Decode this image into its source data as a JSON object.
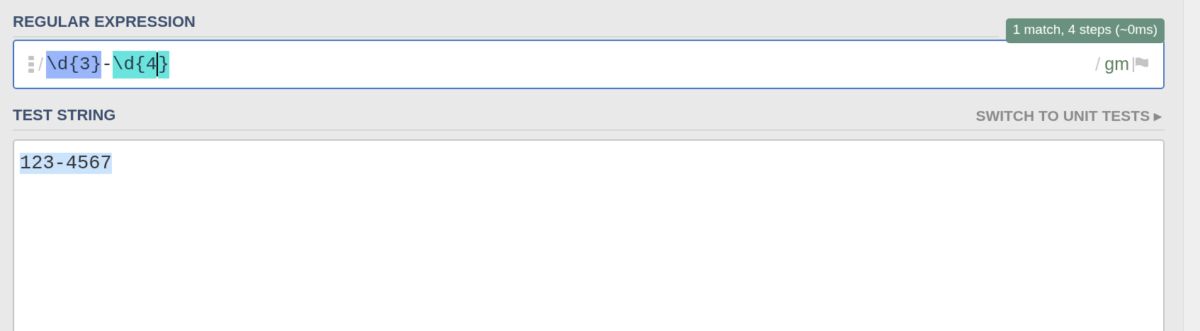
{
  "regex_section": {
    "heading": "REGULAR EXPRESSION",
    "match_info": "1 match, 4 steps (~0ms)",
    "delimiter_open": "/",
    "tokens": [
      {
        "kind": "group",
        "text": "\\d{3}",
        "color": "#99b6fa"
      },
      {
        "kind": "plain",
        "text": "-"
      },
      {
        "kind": "group",
        "text": "\\d{4",
        "color": "#6ae4dd"
      },
      {
        "kind": "cursor"
      },
      {
        "kind": "group",
        "text": "}",
        "color": "#6ae4dd"
      }
    ],
    "delimiter_close": "/",
    "flags": "gm"
  },
  "test_section": {
    "heading": "TEST STRING",
    "switch_link": "SWITCH TO UNIT TESTS ▸",
    "text": "123-4567",
    "matched": true
  }
}
